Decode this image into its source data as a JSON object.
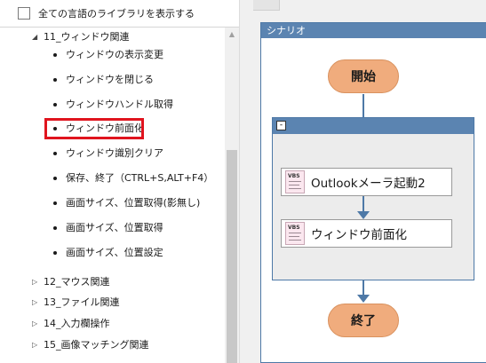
{
  "library_panel": {
    "show_all_label": "全ての言語のライブラリを表示する",
    "expanded_group": "11_ウィンドウ関連",
    "items": [
      "ウィンドウの表示変更",
      "ウィンドウを閉じる",
      "ウィンドウハンドル取得",
      "ウィンドウ前面化",
      "ウィンドウ識別クリア",
      "保存、終了（CTRL+S,ALT+F4）",
      "画面サイズ、位置取得(影無し)",
      "画面サイズ、位置取得",
      "画面サイズ、位置設定"
    ],
    "highlighted_item": "ウィンドウ前面化",
    "collapsed_groups": [
      "12_マウス関連",
      "13_ファイル関連",
      "14_入力欄操作",
      "15_画像マッチング関連"
    ]
  },
  "scenario": {
    "title": "シナリオ",
    "start_label": "開始",
    "end_label": "終了",
    "group_collapse_symbol": "-",
    "actions": [
      {
        "icon_text": "VBS",
        "icon": "vbs-script-icon",
        "label": "Outlookメーラ起動2"
      },
      {
        "icon_text": "VBS",
        "icon": "vbs-script-icon",
        "label": "ウィンドウ前面化"
      }
    ]
  },
  "colors": {
    "accent_blue": "#5b84b1",
    "pill_orange": "#f0ac7d",
    "highlight_red": "#e0141e"
  }
}
